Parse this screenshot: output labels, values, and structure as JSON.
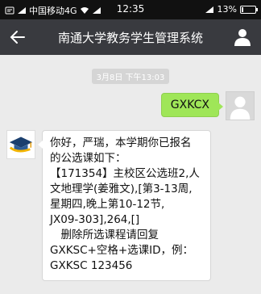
{
  "status_bar": {
    "carrier": "中国移动4G",
    "time": "12:35",
    "battery": "13%",
    "battery_level": 0.13,
    "icons": [
      "notification-icon",
      "signal-icon",
      "wifi-icon",
      "signal-icon",
      "battery-icon"
    ]
  },
  "header": {
    "title": "南通大学教务学生管理系统",
    "back_icon": "arrow-left-icon",
    "profile_icon": "person-icon"
  },
  "chat": {
    "timestamp": "3月8日 下午13:03",
    "messages": [
      {
        "sender": "user",
        "text": "GXKCX"
      },
      {
        "sender": "bot",
        "lines": [
          "你好，严瑞，本学期你已报名",
          "的公选课如下：",
          "【171354】主校区公选班2,人",
          "文地理学(姜雅文),[第3-13周,",
          "星期四,晚上第10-12节,",
          "JX09-303],264,[]",
          "　删除所选课程请回复",
          "GXKSC+空格+选课ID，例：",
          "GXKSC 123456"
        ]
      }
    ]
  },
  "colors": {
    "status_bar_bg": "#111111",
    "header_bg": "#393a3f",
    "chat_bg": "#ebebeb",
    "user_bubble": "#9fe658",
    "bot_bubble": "#ffffff"
  }
}
